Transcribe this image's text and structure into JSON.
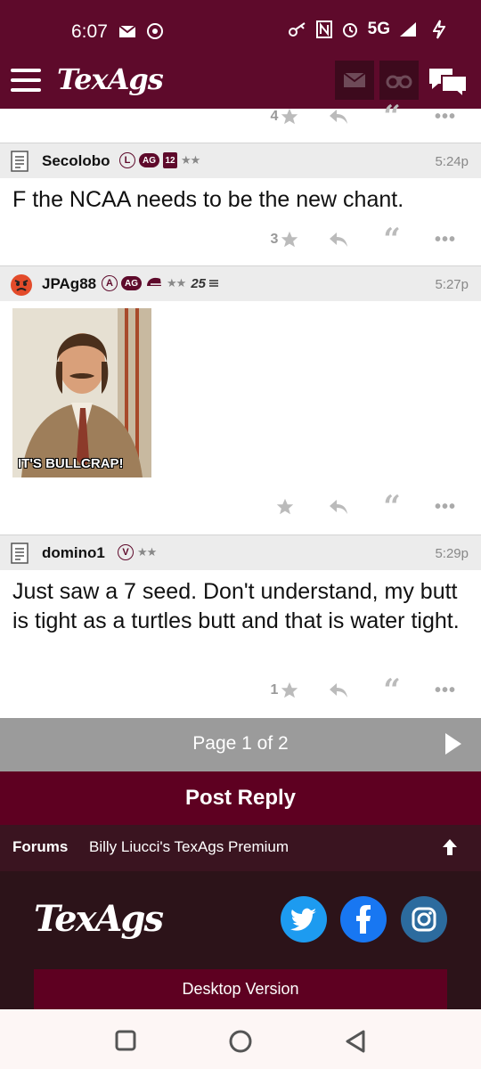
{
  "status_bar": {
    "time": "6:07",
    "network": "5G"
  },
  "app": {
    "logo": "TexAgs"
  },
  "posts": [
    {
      "stars_count": "4"
    },
    {
      "username": "Secolobo",
      "badge_l": "L",
      "badge_ag": "AG",
      "badge_year": "12",
      "time": "5:24p",
      "text": "F the NCAA needs to be the new chant.",
      "stars_count": "3"
    },
    {
      "username": "JPAg88",
      "badge_a": "A",
      "badge_ag": "AG",
      "badge_25": "25",
      "time": "5:27p",
      "gif_caption": "IT'S BULLCRAP!"
    },
    {
      "username": "domino1",
      "badge_v": "V",
      "time": "5:29p",
      "text": "Just saw a 7 seed. Don't understand, my butt is tight as a turtles butt and that is water tight.",
      "stars_count": "1"
    }
  ],
  "pagination": {
    "label": "Page 1 of 2"
  },
  "post_reply": {
    "label": "Post Reply"
  },
  "breadcrumb": {
    "forums": "Forums",
    "section": "Billy Liucci's TexAgs Premium"
  },
  "footer": {
    "logo": "TexAgs",
    "desktop_label": "Desktop Version"
  },
  "colors": {
    "maroon": "#5e0a2b",
    "twitter": "#1d9bf0",
    "facebook": "#1877f2",
    "instagram": "#2c6b9e"
  }
}
